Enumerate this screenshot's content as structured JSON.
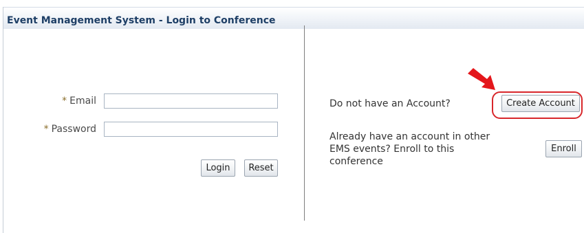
{
  "header": {
    "title": "Event Management System - Login to Conference"
  },
  "login_form": {
    "email": {
      "required_mark": "*",
      "label": "Email",
      "value": ""
    },
    "password": {
      "required_mark": "*",
      "label": "Password",
      "value": ""
    },
    "login_button": "Login",
    "reset_button": "Reset"
  },
  "account_panel": {
    "no_account_text": "Do not have an Account?",
    "create_account_button": "Create Account",
    "enroll_text": "Already have an account in other EMS events? Enroll to this conference",
    "enroll_button": "Enroll"
  },
  "annotation": {
    "color": "#d8262a",
    "icon": "arrow-pointer-icon"
  }
}
